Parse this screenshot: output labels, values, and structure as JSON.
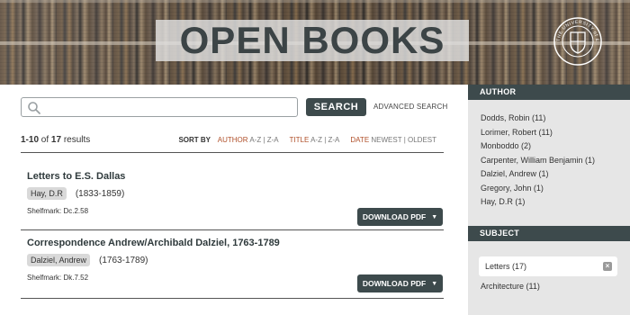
{
  "banner": {
    "title": "OPEN BOOKS",
    "logo_text": "THE UNIVERSITY of EDINBURGH",
    "logo_icon": "university-seal-icon"
  },
  "search": {
    "placeholder": "",
    "value": "",
    "button_label": "SEARCH",
    "advanced_label": "ADVANCED SEARCH"
  },
  "results": {
    "range": "1-10",
    "of_label": "of",
    "total": "17",
    "results_label": "results",
    "sort": {
      "label": "SORT BY",
      "author_key": "AUTHOR",
      "author_opts": "A-Z | Z-A",
      "title_key": "TITLE",
      "title_opts": "A-Z | Z-A",
      "date_key": "DATE",
      "date_opts": "NEWEST | OLDEST"
    }
  },
  "records": [
    {
      "title": "Letters to E.S. Dallas",
      "author": "Hay, D.R",
      "dates": "(1833-1859)",
      "shelfmark": "Shelfmark: Dc.2.58",
      "download_label": "DOWNLOAD PDF"
    },
    {
      "title": "Correspondence Andrew/Archibald Dalziel, 1763-1789",
      "author": "Dalziel, Andrew",
      "dates": "(1763-1789)",
      "shelfmark": "Shelfmark: Dk.7.52",
      "download_label": "DOWNLOAD PDF"
    }
  ],
  "sidebar": {
    "author_heading": "AUTHOR",
    "authors": [
      "Dodds, Robin (11)",
      "Lorimer, Robert (11)",
      "Monboddo (2)",
      "Carpenter, William Benjamin (1)",
      "Dalziel, Andrew (1)",
      "Gregory, John (1)",
      "Hay, D.R (1)"
    ],
    "subject_heading": "SUBJECT",
    "active_subject": "Letters (17)",
    "subjects": [
      "Architecture (11)"
    ]
  },
  "colors": {
    "dark_slate": "#3d4a4c",
    "accent_sort": "#b0502a",
    "sidebar_bg": "#e6e6e6"
  }
}
